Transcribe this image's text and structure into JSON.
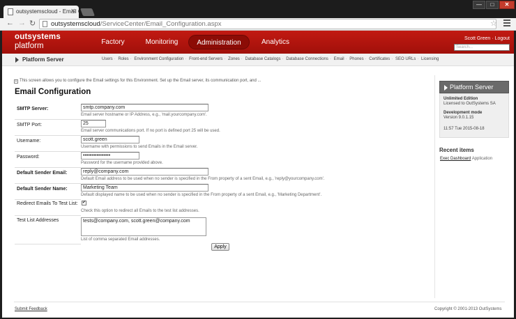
{
  "browser": {
    "tab_title": "outsystemscloud - Email C",
    "url_host": "outsystemscloud",
    "url_path": "/ServiceCenter/Email_Configuration.aspx",
    "window_min": "—",
    "window_max": "□",
    "window_close": "✕"
  },
  "header": {
    "logo_top": "outsystems",
    "logo_bottom": "platform",
    "nav": [
      "Factory",
      "Monitoring",
      "Administration",
      "Analytics"
    ],
    "user": "Scott Green",
    "separator": "·",
    "logout": "Logout",
    "search_placeholder": "Search..."
  },
  "subnav": {
    "title": "Platform Server",
    "links": [
      "Users",
      "Roles",
      "Environment Configuration",
      "Front-end Servers",
      "Zones",
      "Database Catalogs",
      "Database Connections",
      "Email",
      "Phones",
      "Certificates",
      "SEO URLs",
      "Licensing"
    ]
  },
  "intro": "This screen allows you to configure the Email settings for this Environment. Set up the Email server, its communication port, and ...",
  "title": "Email Configuration",
  "form": {
    "smtp_server": {
      "label": "SMTP Server:",
      "value": "smtp.company.com",
      "hint": "Email server hostname or IP Address, e.g., 'mail.yourcompany.com'."
    },
    "smtp_port": {
      "label": "SMTP Port:",
      "value": "25",
      "hint": "Email server communications port. If no port is defined port 25 will be used."
    },
    "username": {
      "label": "Username:",
      "value": "scott.green",
      "hint": "Username with permissions to send Emails in the Email server."
    },
    "password": {
      "label": "Password:",
      "value": "••••••••••••••••",
      "hint": "Password for the username provided above."
    },
    "sender_email": {
      "label": "Default Sender Email:",
      "value": "reply@company.com",
      "hint": "Default Email address to be used when no sender is specified in the From property of a sent Email, e.g., 'reply@yourcompany.com'."
    },
    "sender_name": {
      "label": "Default Sender Name:",
      "value": "Marketing Team",
      "hint": "Default displayed name to be used when no sender is specified in the From property of a sent Email, e.g., 'Marketing Department'."
    },
    "redirect": {
      "label": "Redirect Emails To Test List:",
      "checked": true,
      "check_mark": "✔",
      "hint": "Check this option to redirect all Emails to the test list addresses."
    },
    "test_list": {
      "label": "Test List Addresses",
      "value": "tests@company.com, scott.green@company.com",
      "hint": "List of comma separated Email addresses."
    },
    "apply_label": "Apply"
  },
  "sidebar": {
    "title": "Platform Server",
    "edition": "Unlimited Edition",
    "licensed": "Licensed to OutSystems SA",
    "mode_label": "Development mode",
    "version": "Version 9.0.1.15",
    "timestamp": "11:57 Tue 2015-08-18",
    "recent_title": "Recent items",
    "recent_item": "Exec Dashboard",
    "recent_kind": "Application"
  },
  "footer": {
    "feedback": "Submit Feedback",
    "copyright": "Copyright © 2001-2013 OutSystems"
  }
}
